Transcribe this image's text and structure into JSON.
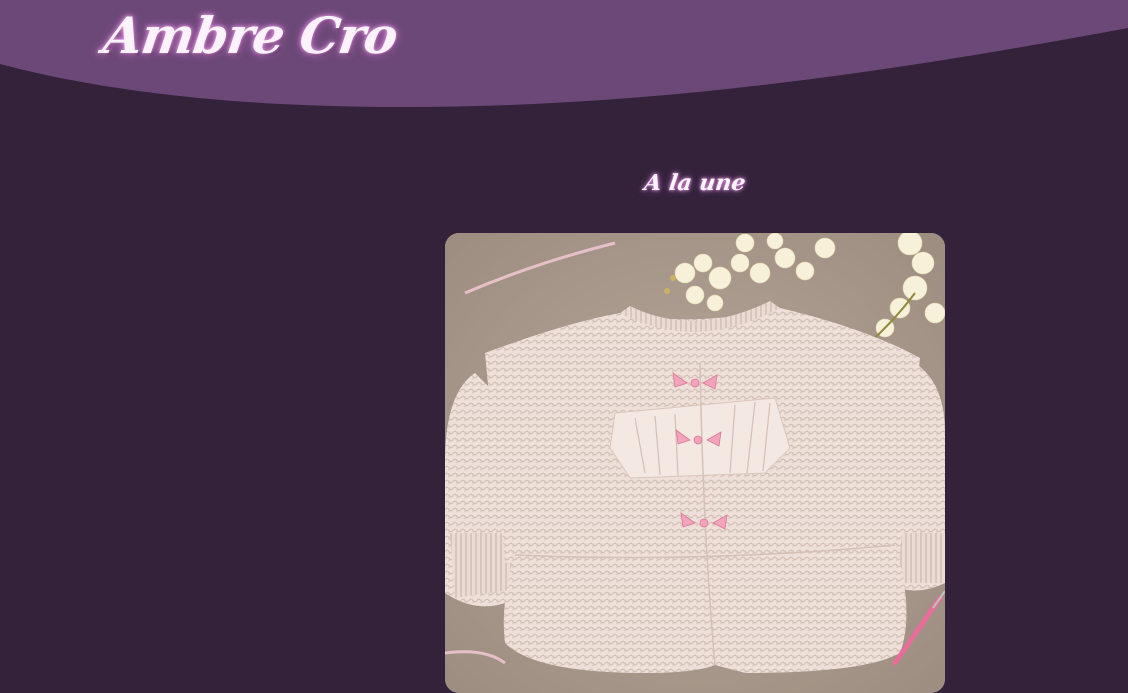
{
  "header": {
    "brand": "Ambre Cro"
  },
  "featured": {
    "title": "A la une",
    "image_alt": "crochet-cardigan-photo"
  },
  "colors": {
    "background": "#33223a",
    "header": "#6b4877",
    "title_glow": "#f0a6f0"
  }
}
